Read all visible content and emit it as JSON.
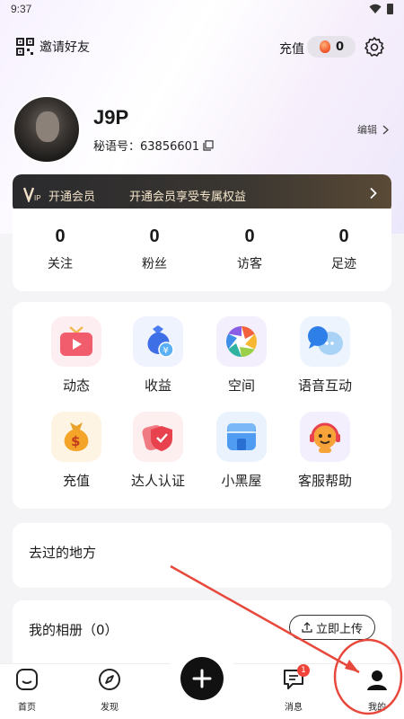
{
  "status_bar": {
    "time": "9:37"
  },
  "top_bar": {
    "invite_label": "邀请好友",
    "recharge_label": "充值",
    "coin_count": "0"
  },
  "profile": {
    "username": "J9P",
    "id_label": "秘语号：63856601",
    "edit_label": "编辑"
  },
  "vip": {
    "title": "开通会员",
    "subtitle": "开通会员享受专属权益"
  },
  "stats": [
    {
      "value": "0",
      "label": "关注"
    },
    {
      "value": "0",
      "label": "粉丝"
    },
    {
      "value": "0",
      "label": "访客"
    },
    {
      "value": "0",
      "label": "足迹"
    }
  ],
  "features": [
    {
      "label": "动态",
      "icon": "video-tv-icon"
    },
    {
      "label": "收益",
      "icon": "money-bag-icon"
    },
    {
      "label": "空间",
      "icon": "aperture-icon"
    },
    {
      "label": "语音互动",
      "icon": "chat-bubble-icon"
    },
    {
      "label": "充值",
      "icon": "coin-bag-icon"
    },
    {
      "label": "达人认证",
      "icon": "shield-badge-icon"
    },
    {
      "label": "小黑屋",
      "icon": "store-icon"
    },
    {
      "label": "客服帮助",
      "icon": "headset-mascot-icon"
    }
  ],
  "places": {
    "title": "去过的地方"
  },
  "album": {
    "title": "我的相册（0）",
    "upload_label": "立即上传"
  },
  "tabs": [
    {
      "label": "首页",
      "icon": "home-icon"
    },
    {
      "label": "发现",
      "icon": "compass-icon"
    },
    {
      "label": "消息",
      "icon": "message-icon",
      "badge": "1"
    },
    {
      "label": "我的",
      "icon": "profile-icon"
    }
  ],
  "colors": {
    "accent_red": "#e8473b",
    "vip_gold": "#f5e2c2",
    "badge_red": "#f0433a"
  }
}
